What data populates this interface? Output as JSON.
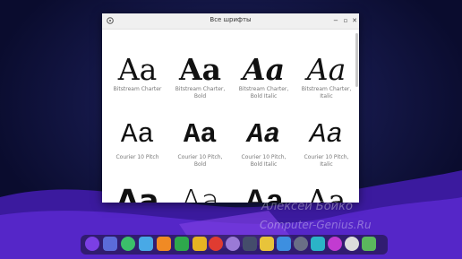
{
  "window": {
    "title": "Все шрифты"
  },
  "fonts": [
    {
      "name_lines": [
        "Bitstream Charter"
      ],
      "sample": "Aa"
    },
    {
      "name_lines": [
        "Bitstream Charter,",
        "Bold"
      ],
      "sample": "Aa"
    },
    {
      "name_lines": [
        "Bitstream Charter,",
        "Bold Italic"
      ],
      "sample": "Aa"
    },
    {
      "name_lines": [
        "Bitstream Charter,",
        "Italic"
      ],
      "sample": "Aa"
    },
    {
      "name_lines": [
        "Courier 10 Pitch"
      ],
      "sample": "Aa"
    },
    {
      "name_lines": [
        "Courier 10 Pitch,",
        "Bold"
      ],
      "sample": "Aa"
    },
    {
      "name_lines": [
        "Courier 10 Pitch,",
        "Bold Italic"
      ],
      "sample": "Aa"
    },
    {
      "name_lines": [
        "Courier 10 Pitch,",
        "Italic"
      ],
      "sample": "Aa"
    },
    {
      "name_lines": [],
      "sample": "Aa"
    },
    {
      "name_lines": [],
      "sample": "Aa"
    },
    {
      "name_lines": [],
      "sample": "Aa"
    },
    {
      "name_lines": [],
      "sample": "Aa"
    }
  ],
  "watermark": {
    "line1": "Алексей Бойко",
    "line2": "Computer-Genius.Ru"
  },
  "dock_icons": [
    "launcher-icon",
    "notes-icon",
    "toggle-icon",
    "files-icon",
    "store-icon",
    "music-icon",
    "video-icon",
    "browser-icon",
    "settings-icon",
    "trash-icon",
    "archive-icon",
    "calendar-icon",
    "network-icon",
    "terminal-icon",
    "power-icon",
    "clock-icon",
    "recycle-icon"
  ]
}
